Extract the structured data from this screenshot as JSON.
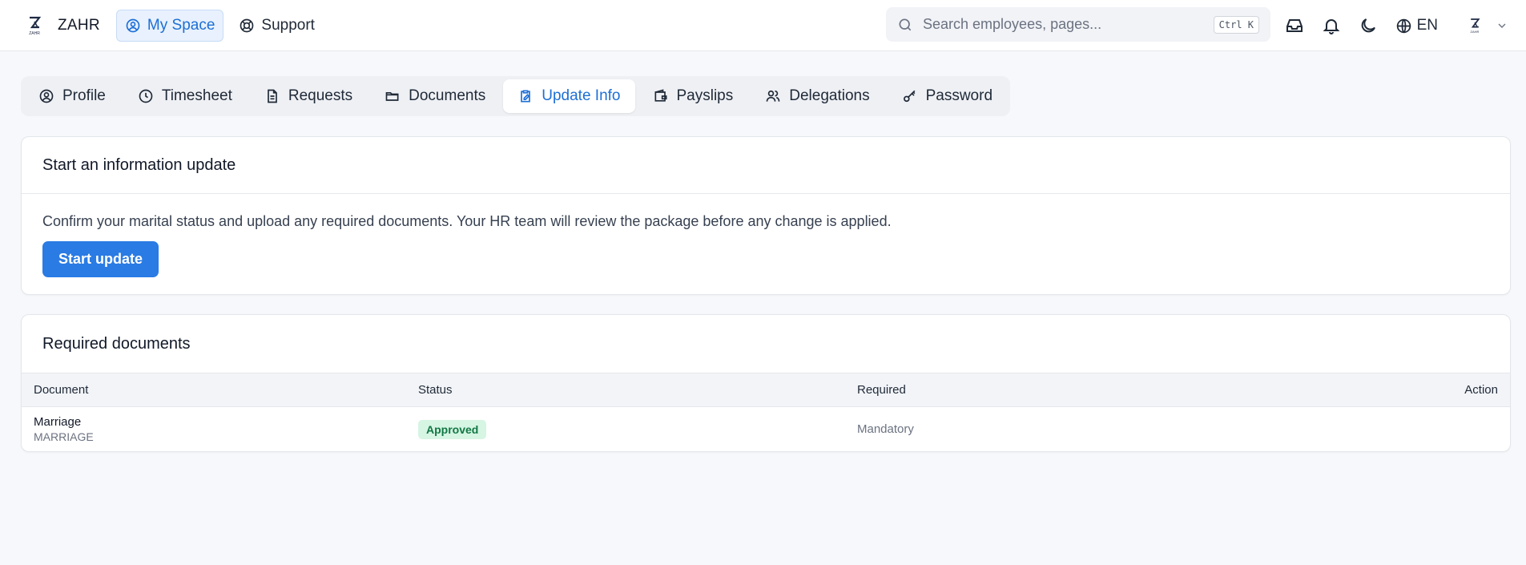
{
  "brand": {
    "name": "ZAHR",
    "logo_text": "ZAHR"
  },
  "topnav": [
    {
      "label": "My Space",
      "icon": "user-circle-icon",
      "active": true
    },
    {
      "label": "Support",
      "icon": "lifebuoy-icon",
      "active": false
    }
  ],
  "search": {
    "placeholder": "Search employees, pages...",
    "shortcut": "Ctrl K"
  },
  "tools": {
    "language": "EN"
  },
  "tabs": [
    {
      "label": "Profile",
      "icon": "user-circle-icon"
    },
    {
      "label": "Timesheet",
      "icon": "clock-icon"
    },
    {
      "label": "Requests",
      "icon": "file-text-icon"
    },
    {
      "label": "Documents",
      "icon": "folder-open-icon"
    },
    {
      "label": "Update Info",
      "icon": "clipboard-edit-icon",
      "active": true
    },
    {
      "label": "Payslips",
      "icon": "wallet-icon"
    },
    {
      "label": "Delegations",
      "icon": "users-icon"
    },
    {
      "label": "Password",
      "icon": "key-icon"
    }
  ],
  "update_card": {
    "title": "Start an information update",
    "description": "Confirm your marital status and upload any required documents. Your HR team will review the package before any change is applied.",
    "button": "Start update"
  },
  "documents_card": {
    "title": "Required documents",
    "columns": [
      "Document",
      "Status",
      "Required",
      "Action"
    ],
    "rows": [
      {
        "name": "Marriage",
        "code": "MARRIAGE",
        "status": "Approved",
        "required": "Mandatory",
        "action": ""
      }
    ]
  },
  "colors": {
    "accent": "#2a7be4",
    "approved_bg": "#d6f5e3",
    "approved_text": "#127744"
  }
}
